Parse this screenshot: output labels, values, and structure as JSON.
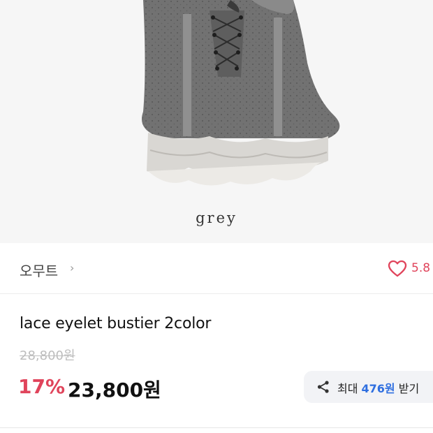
{
  "product_image": {
    "caption": "grey",
    "colors": {
      "fabric": "#6f6f6f",
      "ruffle": "#d8d6d2",
      "lace": "#8a8a8a"
    }
  },
  "brand": {
    "name": "오무트",
    "chevron": "›"
  },
  "like": {
    "icon": "heart-outline-icon",
    "count": "5.8"
  },
  "product": {
    "title": "lace eyelet bustier 2color",
    "original_price": "28,800원",
    "discount": "17%",
    "sale_price": "23,800원"
  },
  "coupon": {
    "icon": "share-icon",
    "prefix": "최대 ",
    "amount": "476원",
    "suffix": " 받기"
  },
  "colors": {
    "accent_red": "#e0445b",
    "accent_blue": "#2f6fe0"
  }
}
